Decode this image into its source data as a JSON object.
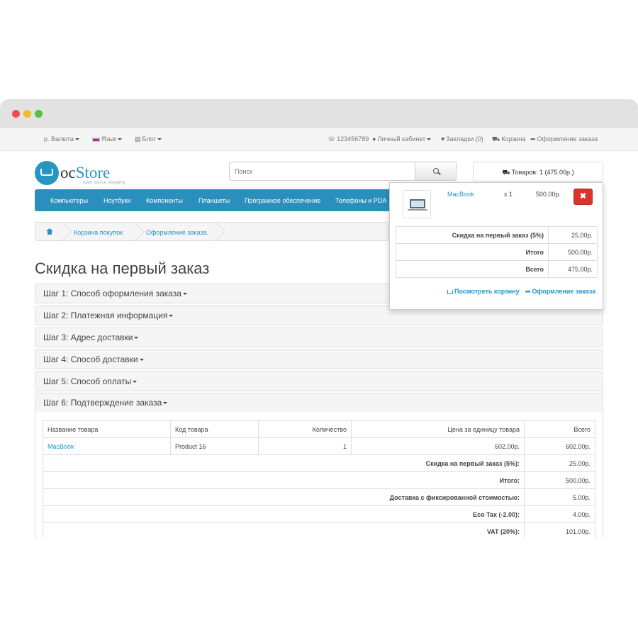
{
  "topbar": {
    "currency": "р. Валюта",
    "language": "Язык",
    "blog": "Блог",
    "phone": "123456789",
    "account": "Личный кабинет",
    "wishlist": "Закладки (0)",
    "cart": "Корзина",
    "checkout": "Оформление заказа"
  },
  "logo": {
    "text_oc": "oc",
    "text_store": "Store",
    "tagline": "open source shopping"
  },
  "search": {
    "placeholder": "Поиск"
  },
  "cart_button": {
    "label": "Товаров: 1 (475.00р.)"
  },
  "menu": {
    "items": [
      "Компьютеры",
      "Ноутбуки",
      "Компоненты",
      "Планшеты",
      "Програмное обеспечение",
      "Телефоны и PDA"
    ]
  },
  "breadcrumb": {
    "items": [
      "Корзина покупок",
      "Оформление заказа."
    ]
  },
  "page_title": "Скидка на первый заказ",
  "steps": [
    "Шаг 1: Способ оформления заказа",
    "Шаг 2: Платежная информация",
    "Шаг 3: Адрес доставки",
    "Шаг 4: Способ доставки",
    "Шаг 5: Способ оплаты",
    "Шаг 6: Подтверждение заказа"
  ],
  "order_table": {
    "headers": [
      "Название товара",
      "Код товара",
      "Количество",
      "Цена за единицу товара",
      "Всего"
    ],
    "row": {
      "name": "MacBook",
      "model": "Product 16",
      "quantity": "1",
      "price": "602.00р.",
      "total": "602.00р."
    },
    "totals": [
      {
        "label": "Скидка на первый заказ (5%):",
        "value": "25.00р."
      },
      {
        "label": "Итого:",
        "value": "500.00р."
      },
      {
        "label": "Доставка с фиксированной стоимостью:",
        "value": "5.00р."
      },
      {
        "label": "Eco Tax (-2.00):",
        "value": "4.00р."
      },
      {
        "label": "VAT (20%):",
        "value": "101.00р."
      }
    ]
  },
  "cart_dropdown": {
    "product": {
      "name": "MacBook",
      "qty": "x 1",
      "price": "500.00р."
    },
    "remove_label": "✖",
    "totals": [
      {
        "label": "Скидка на первый заказ (5%)",
        "value": "25.00р."
      },
      {
        "label": "Итого",
        "value": "500.00р."
      },
      {
        "label": "Всего",
        "value": "475.00р."
      }
    ],
    "view_cart": "Посмотреть корзину",
    "checkout": "Оформление заказа"
  },
  "colors": {
    "accent": "#2a8fbd",
    "link": "#2596c4",
    "danger": "#d9342b"
  }
}
